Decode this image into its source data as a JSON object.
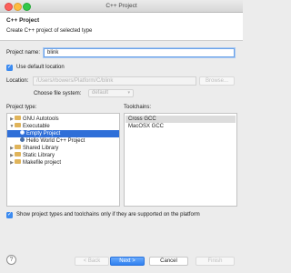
{
  "window": {
    "title": "C++ Project"
  },
  "header": {
    "title": "C++ Project",
    "description": "Create C++ project of selected type"
  },
  "project_name": {
    "label": "Project name:",
    "value": "blink"
  },
  "use_default_location": {
    "label": "Use default location",
    "checked": true
  },
  "location": {
    "label": "Location:",
    "value": "/Users/rbowers/Platform/C/blink",
    "browse_label": "Browse..."
  },
  "filesystem": {
    "label": "Choose file system:",
    "value": "default"
  },
  "project_type": {
    "label": "Project type:",
    "items": [
      {
        "label": "GNU Autotools",
        "selected": false
      },
      {
        "label": "Executable",
        "selected": false
      },
      {
        "label": "Empty Project",
        "selected": true
      },
      {
        "label": "Hello World C++ Project",
        "selected": false
      },
      {
        "label": "Shared Library",
        "selected": false
      },
      {
        "label": "Static Library",
        "selected": false
      },
      {
        "label": "Makefile project",
        "selected": false
      }
    ]
  },
  "toolchains": {
    "label": "Toolchains:",
    "items": [
      {
        "label": "Cross GCC",
        "selected": true
      },
      {
        "label": "MacOSX GCC",
        "selected": false
      }
    ]
  },
  "show_supported": {
    "label": "Show project types and toolchains only if they are supported on the platform",
    "checked": true
  },
  "footer": {
    "help_glyph": "?",
    "back_label": "< Back",
    "next_label": "Next >",
    "cancel_label": "Cancel",
    "finish_label": "Finish"
  },
  "colors": {
    "accent": "#2f6fd8",
    "primary_button": "#3d8ef6",
    "folder": "#e0b45a"
  }
}
